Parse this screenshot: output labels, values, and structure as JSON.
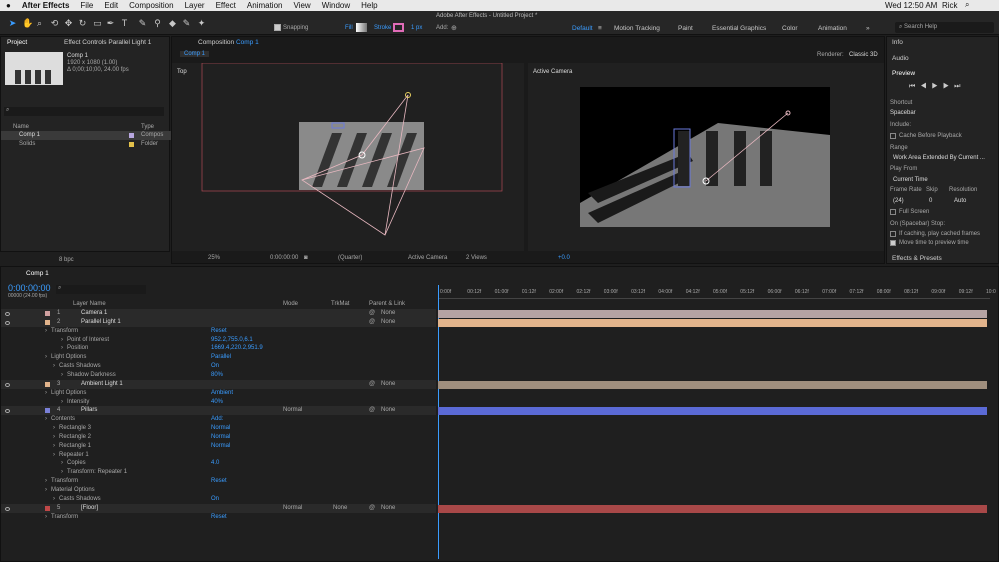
{
  "menubar": {
    "apple": "",
    "app": "After Effects",
    "items": [
      "File",
      "Edit",
      "Composition",
      "Layer",
      "Effect",
      "Animation",
      "View",
      "Window",
      "Help"
    ],
    "title": "Adobe After Effects - Untitled Project *",
    "clock": "Wed 12:50 AM",
    "user": "Rick"
  },
  "toolbar": {
    "snapping": "Snapping",
    "fill": "Fill",
    "stroke": "Stroke",
    "px": "1 px",
    "add": "Add:",
    "workspaces": [
      "Default",
      "Motion Tracking",
      "Paint",
      "Essential Graphics",
      "Color",
      "Animation"
    ],
    "search": "Search Help"
  },
  "project": {
    "tab": "Project",
    "effect_tab": "Effect Controls Parallel Light 1",
    "comp_name": "Comp 1",
    "comp_size": "1920 x 1080 (1.00)",
    "comp_dur": "Δ 0;00;10;00, 24.00 fps",
    "col_name": "Name",
    "col_type": "Type",
    "items": [
      {
        "name": "Comp 1",
        "type": "Compos"
      },
      {
        "name": "Solids",
        "type": "Folder"
      }
    ],
    "bpc": "8 bpc"
  },
  "composition": {
    "tab": "Composition Comp 1",
    "subtab": "Comp 1",
    "renderer_label": "Renderer:",
    "renderer": "Classic 3D",
    "left_view": "Top",
    "right_view": "Active Camera",
    "zoom": "25%",
    "timecode": "0:00:00:00",
    "quality": "(Quarter)",
    "camera": "Active Camera",
    "views": "2 Views",
    "exposure": "+0.0"
  },
  "right_panel": {
    "info": "Info",
    "audio": "Audio",
    "preview": "Preview",
    "shortcut_label": "Shortcut",
    "shortcut": "Spacebar",
    "include": "Include:",
    "cache": "Cache Before Playback",
    "range_label": "Range",
    "range": "Work Area Extended By Current ...",
    "play_from_label": "Play From",
    "play_from": "Current Time",
    "frame_rate_label": "Frame Rate",
    "skip_label": "Skip",
    "resolution_label": "Resolution",
    "frame_rate": "(24)",
    "skip": "0",
    "resolution": "Auto",
    "full_screen": "Full Screen",
    "stop_label": "On (Spacebar) Stop:",
    "if_caching": "If caching, play cached frames",
    "move_time": "Move time to preview time",
    "effects": "Effects & Presets"
  },
  "timeline": {
    "tab": "Comp 1",
    "timecode": "0:00:00:00",
    "fps": "00000 (24.00 fps)",
    "col_name": "Layer Name",
    "col_mode": "Mode",
    "col_trkmat": "TrkMat",
    "col_parent": "Parent & Link",
    "ruler": [
      "0:00f",
      "00:12f",
      "01:00f",
      "01:12f",
      "02:00f",
      "02:12f",
      "03:00f",
      "03:12f",
      "04:00f",
      "04:12f",
      "05:00f",
      "05:12f",
      "06:00f",
      "06:12f",
      "07:00f",
      "07:12f",
      "08:00f",
      "08:12f",
      "09:00f",
      "09:12f",
      "10:0"
    ],
    "rows": [
      {
        "num": "1",
        "name": "Camera 1",
        "parent": "None",
        "bar": "#b5a3a3",
        "color": "#d0a0a0"
      },
      {
        "num": "2",
        "name": "Parallel Light 1",
        "parent": "None",
        "bar": "#e2b48c",
        "color": "#e2b48c"
      },
      {
        "prop": "Transform",
        "value": "Reset",
        "indent": 1
      },
      {
        "prop": "Point of Interest",
        "value": "952.2,755.0,6.1",
        "indent": 3
      },
      {
        "prop": "Position",
        "value": "1669.4,220.2,951.9",
        "indent": 3
      },
      {
        "prop": "Light Options",
        "value": "Parallel",
        "indent": 1
      },
      {
        "prop": "Casts Shadows",
        "value": "On",
        "indent": 2
      },
      {
        "prop": "Shadow Darkness",
        "value": "80%",
        "indent": 3
      },
      {
        "num": "3",
        "name": "Ambient Light 1",
        "parent": "None",
        "bar": "#a08f7e",
        "color": "#e2b48c"
      },
      {
        "prop": "Light Options",
        "value": "Ambient",
        "indent": 1
      },
      {
        "prop": "Intensity",
        "value": "40%",
        "indent": 3
      },
      {
        "num": "4",
        "name": "Pillars",
        "mode": "Normal",
        "parent": "None",
        "bar": "#5b6ad6",
        "color": "#7a80d8"
      },
      {
        "prop": "Contents",
        "value": "Add:",
        "indent": 1
      },
      {
        "prop": "Rectangle 3",
        "value": "Normal",
        "indent": 2
      },
      {
        "prop": "Rectangle 2",
        "value": "Normal",
        "indent": 2
      },
      {
        "prop": "Rectangle 1",
        "value": "Normal",
        "indent": 2
      },
      {
        "prop": "Repeater 1",
        "value": "",
        "indent": 2
      },
      {
        "prop": "Copies",
        "value": "4.0",
        "indent": 3
      },
      {
        "prop": "Transform: Repeater 1",
        "value": "",
        "indent": 3
      },
      {
        "prop": "Transform",
        "value": "Reset",
        "indent": 1
      },
      {
        "prop": "Material Options",
        "value": "",
        "indent": 1
      },
      {
        "prop": "Casts Shadows",
        "value": "On",
        "indent": 2
      },
      {
        "num": "5",
        "name": "[Floor]",
        "mode": "Normal",
        "trkmat": "None",
        "parent": "None",
        "bar": "#a84848",
        "color": "#c04848"
      },
      {
        "prop": "Transform",
        "value": "Reset",
        "indent": 1
      }
    ]
  },
  "colors": {
    "accent": "#3a9cff",
    "panel": "#232323"
  }
}
